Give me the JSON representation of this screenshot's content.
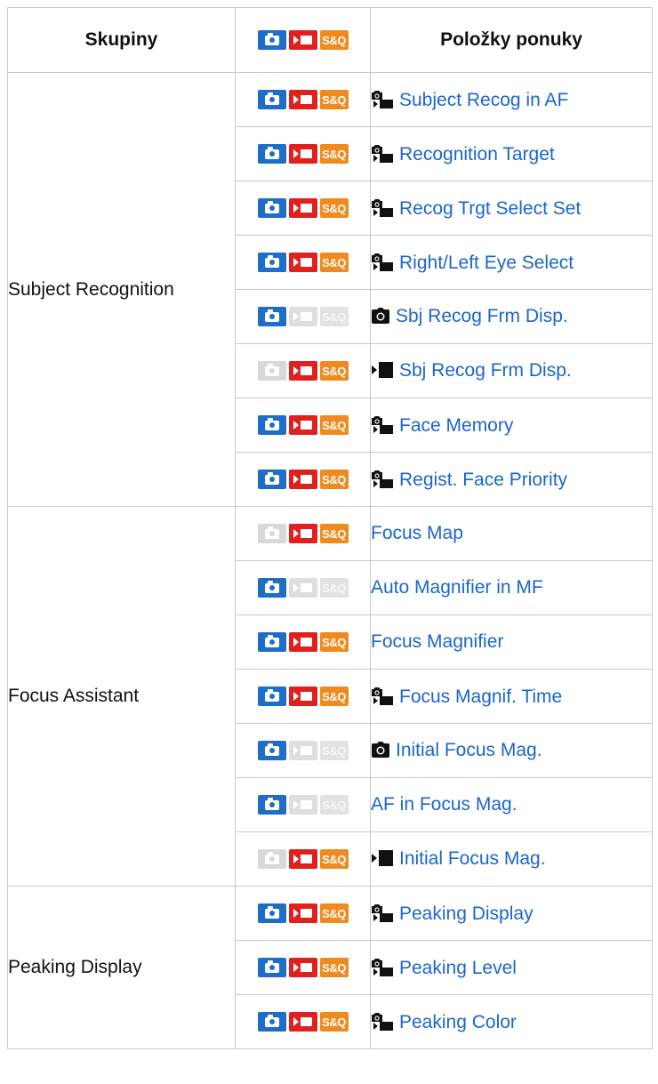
{
  "header": {
    "groups": "Skupiny",
    "modes_icon": "photo-movie-sq-mode-icons",
    "items": "Položky ponuky"
  },
  "mode_labels": {
    "sq": "S&Q"
  },
  "groups": {
    "subject_recognition": "Subject Recognition",
    "focus_assistant": "Focus Assistant",
    "peaking_display": "Peaking Display"
  },
  "rows": [
    {
      "item": "Subject Recog in AF",
      "icon": "photo-movie-icon",
      "modes": [
        true,
        true,
        true
      ]
    },
    {
      "item": "Recognition Target",
      "icon": "photo-movie-icon",
      "modes": [
        true,
        true,
        true
      ]
    },
    {
      "item": "Recog Trgt Select Set",
      "icon": "photo-movie-icon",
      "modes": [
        true,
        true,
        true
      ]
    },
    {
      "item": "Right/Left Eye Select",
      "icon": "photo-movie-icon",
      "modes": [
        true,
        true,
        true
      ]
    },
    {
      "item": "Sbj Recog Frm Disp.",
      "icon": "camera-icon",
      "modes": [
        true,
        false,
        false
      ]
    },
    {
      "item": "Sbj Recog Frm Disp.",
      "icon": "movie-icon",
      "modes": [
        false,
        true,
        true
      ]
    },
    {
      "item": "Face Memory",
      "icon": "photo-movie-icon",
      "modes": [
        true,
        true,
        true
      ]
    },
    {
      "item": "Regist. Face Priority",
      "icon": "photo-movie-icon",
      "modes": [
        true,
        true,
        true
      ]
    },
    {
      "item": "Focus Map",
      "icon": "",
      "modes": [
        false,
        true,
        true
      ]
    },
    {
      "item": "Auto Magnifier in MF",
      "icon": "",
      "modes": [
        true,
        false,
        false
      ]
    },
    {
      "item": "Focus Magnifier",
      "icon": "",
      "modes": [
        true,
        true,
        true
      ]
    },
    {
      "item": "Focus Magnif. Time",
      "icon": "photo-movie-icon",
      "modes": [
        true,
        true,
        true
      ]
    },
    {
      "item": "Initial Focus Mag.",
      "icon": "camera-icon",
      "modes": [
        true,
        false,
        false
      ]
    },
    {
      "item": "AF in Focus Mag.",
      "icon": "",
      "modes": [
        true,
        false,
        false
      ]
    },
    {
      "item": "Initial Focus Mag.",
      "icon": "movie-icon",
      "modes": [
        false,
        true,
        true
      ]
    },
    {
      "item": "Peaking Display",
      "icon": "photo-movie-icon",
      "modes": [
        true,
        true,
        true
      ]
    },
    {
      "item": "Peaking Level",
      "icon": "photo-movie-icon",
      "modes": [
        true,
        true,
        true
      ]
    },
    {
      "item": "Peaking Color",
      "icon": "photo-movie-icon",
      "modes": [
        true,
        true,
        true
      ]
    }
  ],
  "colors": {
    "photo": "#1e6ec8",
    "movie": "#e0201c",
    "sq": "#ef8a1e",
    "link": "#1a66cc",
    "border": "#c8c8c8"
  }
}
